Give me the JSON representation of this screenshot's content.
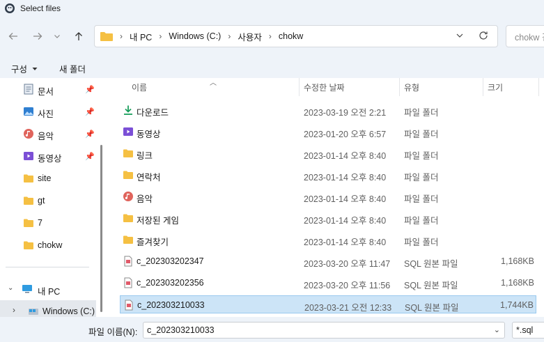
{
  "window": {
    "title": "Select files"
  },
  "address": {
    "crumbs": [
      "내 PC",
      "Windows (C:)",
      "사용자",
      "chokw"
    ],
    "search_placeholder": "chokw 검색"
  },
  "commands": {
    "organize": "구성",
    "new_folder": "새 폴더"
  },
  "sidebar": {
    "pinned": [
      {
        "label": "문서",
        "icon": "document-icon"
      },
      {
        "label": "사진",
        "icon": "pictures-icon"
      },
      {
        "label": "음악",
        "icon": "music-icon"
      },
      {
        "label": "동영상",
        "icon": "video-icon"
      }
    ],
    "folders": [
      "site",
      "gt",
      "7",
      "chokw"
    ],
    "this_pc": "내 PC",
    "drive": "Windows (C:)"
  },
  "columns": {
    "name": "이름",
    "modified": "수정한 날짜",
    "type": "유형",
    "size": "크기"
  },
  "files": [
    {
      "name": "다운로드",
      "date": "2023-03-19 오전 2:21",
      "type": "파일 폴더",
      "size": "",
      "icon": "download-icon"
    },
    {
      "name": "동영상",
      "date": "2023-01-20 오후 6:57",
      "type": "파일 폴더",
      "size": "",
      "icon": "video-icon"
    },
    {
      "name": "링크",
      "date": "2023-01-14 오후 8:40",
      "type": "파일 폴더",
      "size": "",
      "icon": "folder-icon"
    },
    {
      "name": "연락처",
      "date": "2023-01-14 오후 8:40",
      "type": "파일 폴더",
      "size": "",
      "icon": "folder-icon"
    },
    {
      "name": "음악",
      "date": "2023-01-14 오후 8:40",
      "type": "파일 폴더",
      "size": "",
      "icon": "music-icon"
    },
    {
      "name": "저장된 게임",
      "date": "2023-01-14 오후 8:40",
      "type": "파일 폴더",
      "size": "",
      "icon": "folder-icon"
    },
    {
      "name": "즐겨찾기",
      "date": "2023-01-14 오후 8:40",
      "type": "파일 폴더",
      "size": "",
      "icon": "folder-icon"
    },
    {
      "name": "c_202303202347",
      "date": "2023-03-20 오후 11:47",
      "type": "SQL 원본 파일",
      "size": "1,168KB",
      "icon": "sql-file-icon"
    },
    {
      "name": "c_202303202356",
      "date": "2023-03-20 오후 11:56",
      "type": "SQL 원본 파일",
      "size": "1,168KB",
      "icon": "sql-file-icon"
    },
    {
      "name": "c_202303210033",
      "date": "2023-03-21 오전 12:33",
      "type": "SQL 원본 파일",
      "size": "1,744KB",
      "icon": "sql-file-icon",
      "selected": true
    }
  ],
  "footer": {
    "filename_label": "파일 이름(N):",
    "filename_value": "c_202303210033",
    "filetype_value": "*.sql"
  },
  "colors": {
    "folder": "#f5c043",
    "selection": "#cce4f7",
    "chrome": "#eef3f9"
  }
}
